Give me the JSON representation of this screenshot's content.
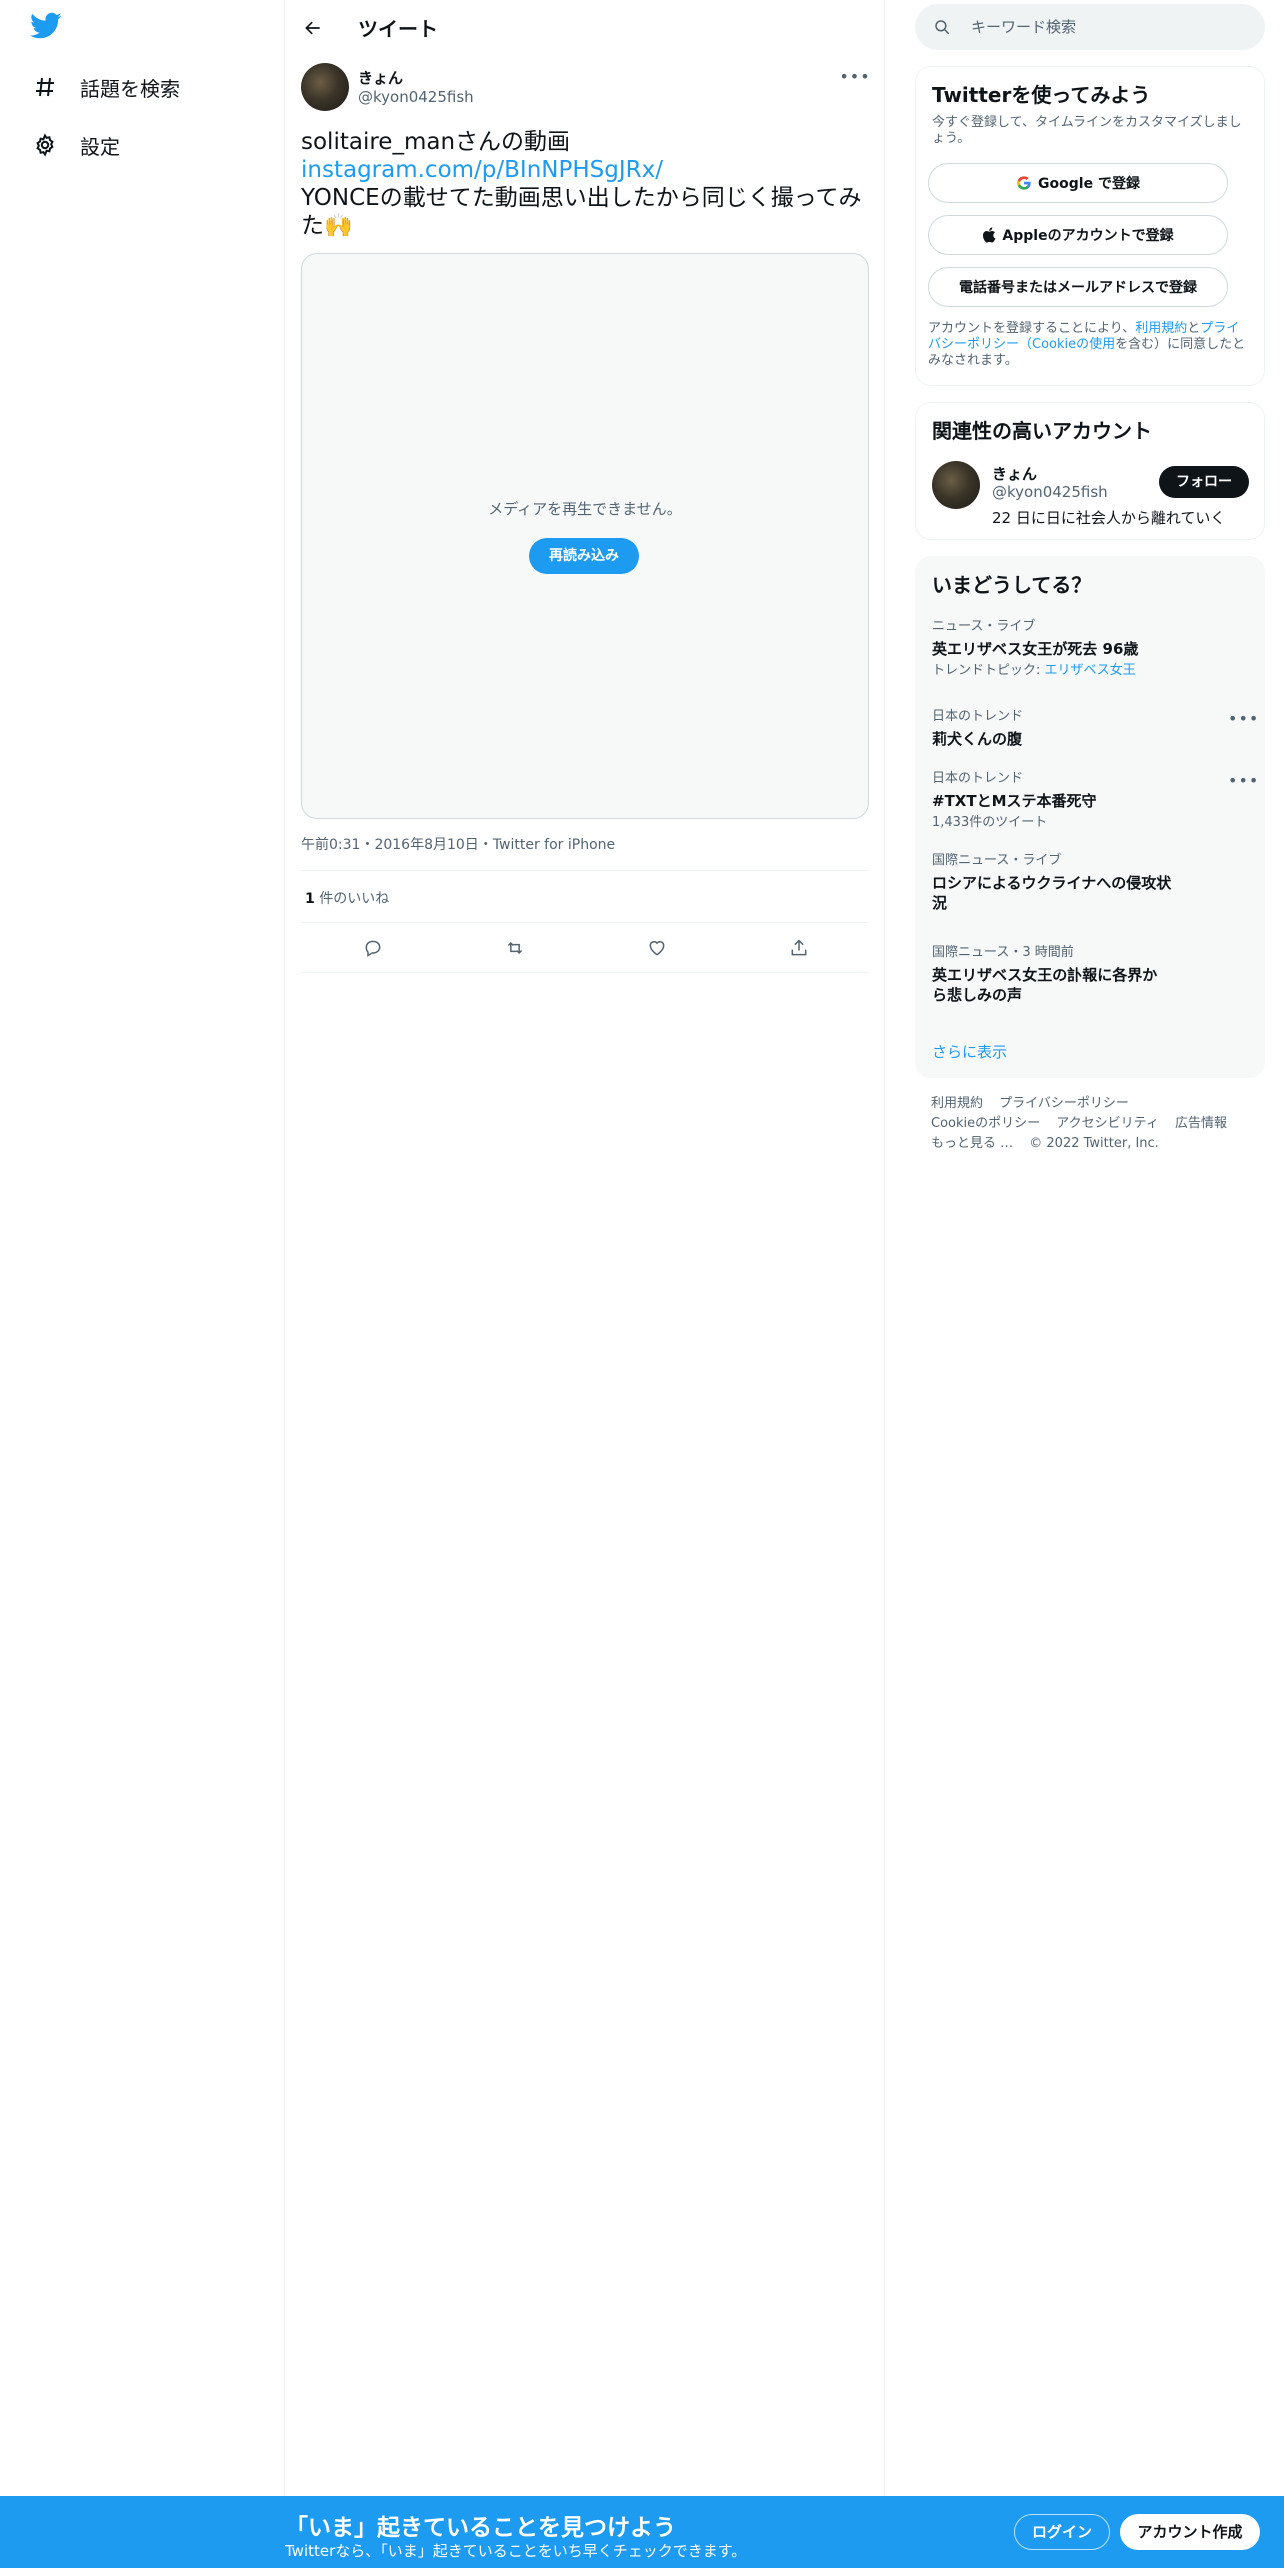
{
  "nav": {
    "items": [
      {
        "label": "話題を検索",
        "icon": "hashtag-icon"
      },
      {
        "label": "設定",
        "icon": "gear-icon"
      }
    ]
  },
  "header": {
    "title": "ツイート"
  },
  "tweet": {
    "author_name": "きょん",
    "author_handle": "@kyon0425fish",
    "text_line1": "solitaire_manさんの動画",
    "link": "instagram.com/p/BInNPHSgJRx/",
    "text_line2": "YONCEの載せてた動画思い出したから同じく撮ってみた🙌",
    "media_message": "メディアを再生できません。",
    "reload_label": "再読み込み",
    "meta": "午前0:31・2016年8月10日・Twitter for iPhone",
    "likes_count": "1",
    "likes_label": " 件のいいね"
  },
  "search": {
    "placeholder": "キーワード検索"
  },
  "signup_card": {
    "title": "Twitterを使ってみよう",
    "subtitle": "今すぐ登録して、タイムラインをカスタマイズしましょう。",
    "google_label": "Google で登録",
    "apple_label": "Appleのアカウントで登録",
    "phone_label": "電話番号またはメールアドレスで登録",
    "terms_prefix": "アカウントを登録することにより、",
    "terms_link1": "利用規約",
    "terms_mid": "と",
    "terms_link2": "プライバシーポリシー（Cookieの使用",
    "terms_suffix": "を含む）に同意したとみなされます。"
  },
  "related": {
    "title": "関連性の高いアカウント",
    "name": "きょん",
    "handle": "@kyon0425fish",
    "bio": "22 日に日に社会人から離れていく",
    "follow_label": "フォロー"
  },
  "trends": {
    "title": "いまどうしてる？",
    "items": [
      {
        "meta": "ニュース・ライブ",
        "title": "英エリザベス女王が死去 96歳",
        "sub_prefix": "トレンドトピック: ",
        "sub_link": "エリザベス女王"
      },
      {
        "meta": "日本のトレンド",
        "title": "莉犬くんの腹"
      },
      {
        "meta": "日本のトレンド",
        "title": "#TXTとMステ本番死守",
        "sub": "1,433件のツイート"
      },
      {
        "meta": "国際ニュース・ライブ",
        "title": "ロシアによるウクライナへの侵攻状況"
      },
      {
        "meta": "国際ニュース・3 時間前",
        "title": "英エリザベス女王の訃報に各界から悲しみの声"
      }
    ],
    "show_more": "さらに表示"
  },
  "footer": {
    "links": [
      "利用規約",
      "プライバシーポリシー",
      "Cookieのポリシー",
      "アクセシビリティ",
      "広告情報",
      "もっと見る …"
    ],
    "copyright": "© 2022 Twitter, Inc."
  },
  "bottom_bar": {
    "title": "「いま」起きていることを見つけよう",
    "subtitle": "Twitterなら、「いま」起きていることをいち早くチェックできます。",
    "login_label": "ログイン",
    "signup_label": "アカウント作成"
  },
  "colors": {
    "accent": "#1d9bf0",
    "text": "#0f1419",
    "secondary": "#536471"
  }
}
